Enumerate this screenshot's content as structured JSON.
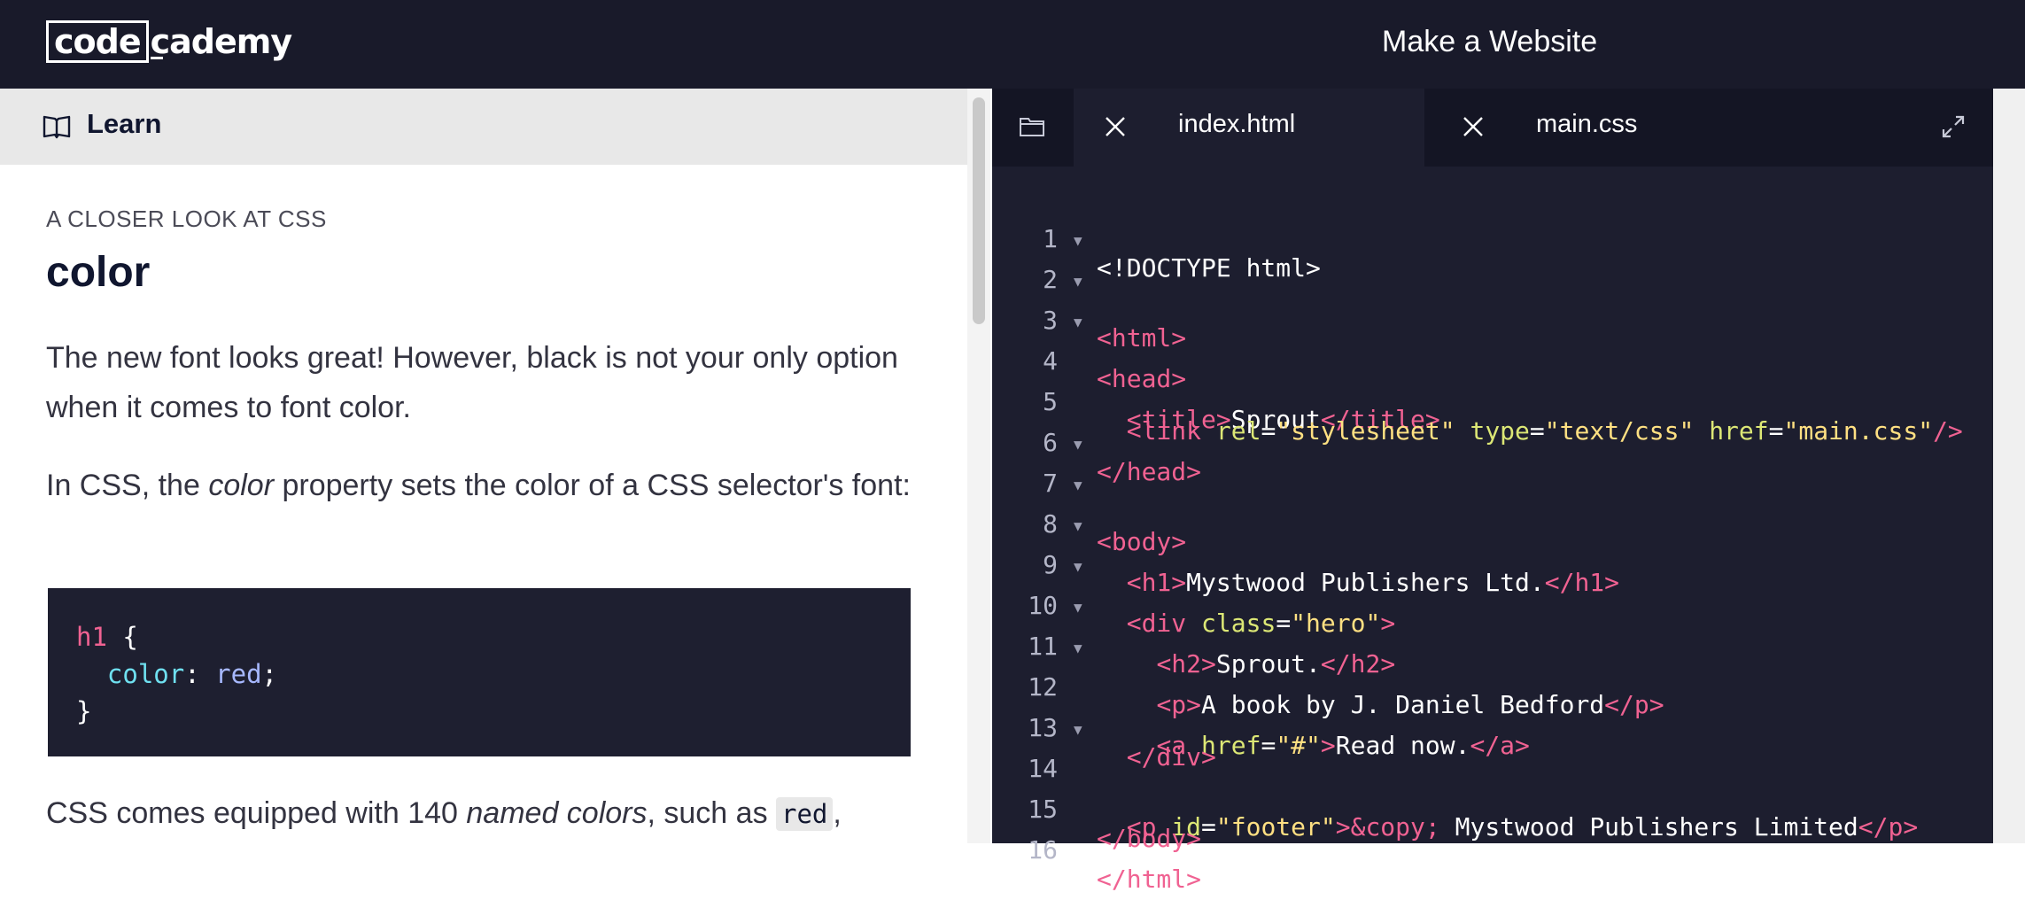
{
  "header": {
    "logo_part1": "code",
    "logo_part2": "cademy",
    "project_title": "Make a Website"
  },
  "learn": {
    "tab_label": "Learn",
    "kicker": "A CLOSER LOOK AT CSS",
    "title": "color",
    "para1": "The new font looks great! However, black is not your only option when it comes to font color.",
    "para2_before": "In CSS, the ",
    "para2_em": "color",
    "para2_after": " property sets the color of a CSS selector's font:",
    "code_example": {
      "line1_sel": "h1",
      "line1_rest": " {",
      "line2_indent": "  ",
      "line2_prop": "color",
      "line2_colon": ": ",
      "line2_val": "red",
      "line2_semi": ";",
      "line3": "}"
    },
    "para3_before": "CSS comes equipped with 140 ",
    "para3_em": "named colors",
    "para3_mid": ", such as ",
    "para3_code": "red",
    "para3_after": ","
  },
  "editor": {
    "tabs": [
      {
        "label": "index.html",
        "active": true
      },
      {
        "label": "main.css",
        "active": false
      }
    ],
    "lines": [
      {
        "n": "1",
        "fold": false
      },
      {
        "n": "2",
        "fold": true
      },
      {
        "n": "3",
        "fold": true
      },
      {
        "n": "4",
        "fold": true
      },
      {
        "n": "5",
        "fold": false
      },
      {
        "n": "6",
        "fold": false
      },
      {
        "n": "7",
        "fold": true
      },
      {
        "n": "8",
        "fold": true
      },
      {
        "n": "9",
        "fold": true
      },
      {
        "n": "10",
        "fold": true
      },
      {
        "n": "11",
        "fold": true
      },
      {
        "n": "12",
        "fold": true
      },
      {
        "n": "13",
        "fold": false
      },
      {
        "n": "14",
        "fold": true
      },
      {
        "n": "15",
        "fold": false
      },
      {
        "n": "16",
        "fold": false
      }
    ],
    "code": {
      "l1": "<!DOCTYPE html>",
      "l2": "<html>",
      "l3": "<head>",
      "l4_open": "<title>",
      "l4_text": "Sprout",
      "l4_close": "</title>",
      "l5_tag": "<link",
      "l5_a1": "rel",
      "l5_v1": "\"stylesheet\"",
      "l5_a2": "type",
      "l5_v2": "\"text/css\"",
      "l5_a3": "href",
      "l5_v3": "\"main.css\"",
      "l5_end": "/>",
      "l6": "</head>",
      "l7": "<body>",
      "l8_open": "<h1>",
      "l8_text": "Mystwood Publishers Ltd.",
      "l8_close": "</h1>",
      "l9_tag": "<div",
      "l9_attr": "class",
      "l9_val": "\"hero\"",
      "l9_end": ">",
      "l10_open": "<h2>",
      "l10_text": "Sprout.",
      "l10_close": "</h2>",
      "l11_open": "<p>",
      "l11_text": "A book by J. Daniel Bedford",
      "l11_close": "</p>",
      "l12_tag": "<a",
      "l12_attr": "href",
      "l12_val": "\"#\"",
      "l12_end": ">",
      "l12_text": "Read now.",
      "l12_close": "</a>",
      "l13": "</div>",
      "l14_tag": "<p",
      "l14_attr": "id",
      "l14_val": "\"footer\"",
      "l14_end": ">",
      "l14_entity": "&copy;",
      "l14_text": " Mystwood Publishers Limited",
      "l14_close": "</p>",
      "l15": "</body>",
      "l16": "</html>"
    }
  },
  "colors": {
    "topbar_bg": "#191a2a",
    "editor_bg": "#1d1e2f",
    "tag": "#f06292",
    "attr": "#dce775",
    "string": "#ffe082"
  }
}
